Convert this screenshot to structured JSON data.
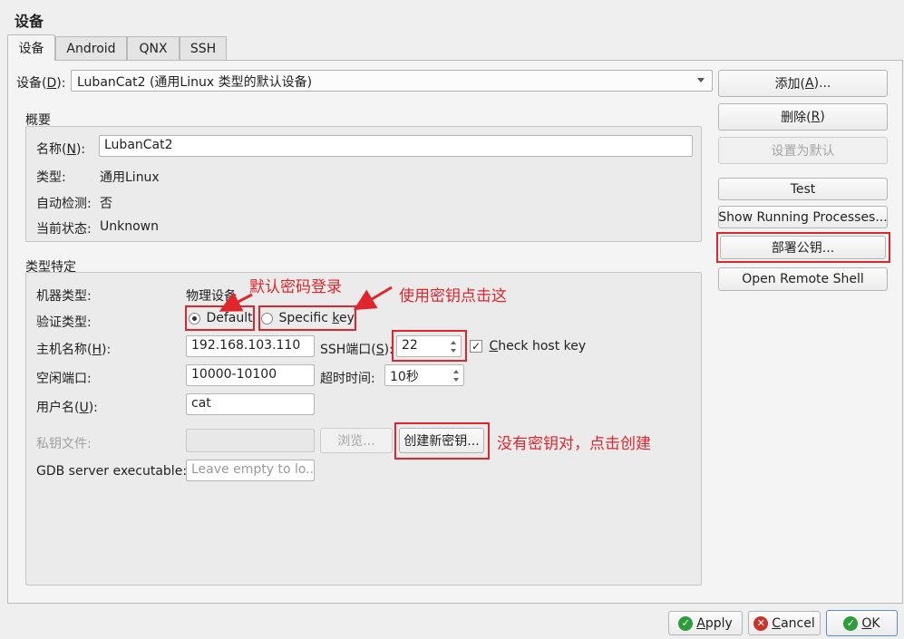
{
  "title": "设备",
  "tabs": [
    {
      "label": "设备"
    },
    {
      "label": "Android"
    },
    {
      "label": "QNX"
    },
    {
      "label": "SSH"
    }
  ],
  "device": {
    "label_prefix": "设备(",
    "label_key": "D",
    "label_suffix": "):",
    "value": "LubanCat2 (通用Linux 类型的默认设备)"
  },
  "overview": {
    "title": "概要",
    "name_label_prefix": "名称(",
    "name_label_key": "N",
    "name_label_suffix": "):",
    "name_value": "LubanCat2",
    "type_label": "类型:",
    "type_value": "通用Linux",
    "autodetect_label": "自动检测:",
    "autodetect_value": "否",
    "state_label": "当前状态:",
    "state_value": "Unknown"
  },
  "specific": {
    "title": "类型特定",
    "machine_type_label": "机器类型:",
    "machine_type_value": "物理设备",
    "auth_label": "验证类型:",
    "auth_default": "Default",
    "auth_specific_prefix": "Specific ",
    "auth_specific_key": "k",
    "auth_specific_suffix": "ey",
    "host_label_prefix": "主机名称(",
    "host_label_key": "H",
    "host_label_suffix": "):",
    "host_value": "192.168.103.110",
    "ssh_port_label_prefix": "SSH端口(",
    "ssh_port_label_key": "S",
    "ssh_port_label_suffix": "):",
    "ssh_port_value": "22",
    "check_host_key_prefix": "",
    "check_host_key_key": "C",
    "check_host_key_suffix": "heck host key",
    "check_host_key_checked": true,
    "free_ports_label": "空闲端口:",
    "free_ports_value": "10000-10100",
    "timeout_label": "超时时间:",
    "timeout_value": "10秒",
    "user_label_prefix": "用户名(",
    "user_label_key": "U",
    "user_label_suffix": "):",
    "user_value": "cat",
    "private_key_label": "私钥文件:",
    "browse_label": "浏览...",
    "create_key_label": "创建新密钥...",
    "gdb_label": "GDB server executable:",
    "gdb_placeholder": "Leave empty to lo..."
  },
  "side_buttons": {
    "add_prefix": "添加(",
    "add_key": "A",
    "add_suffix": ")...",
    "remove_prefix": "删除(",
    "remove_key": "R",
    "remove_suffix": ")",
    "set_default": "设置为默认",
    "test": "Test",
    "show_processes": "Show Running Processes...",
    "deploy_key": "部署公钥...",
    "open_shell": "Open Remote Shell"
  },
  "annotations": {
    "default_login": "默认密码登录",
    "use_key": "使用密钥点击这",
    "no_keypair": "没有密钥对，点击创建"
  },
  "bottom": {
    "apply_prefix": "",
    "apply_key": "A",
    "apply_suffix": "pply",
    "cancel_prefix": "",
    "cancel_key": "C",
    "cancel_suffix": "ancel",
    "ok_prefix": "",
    "ok_key": "O",
    "ok_suffix": "K"
  },
  "colors": {
    "annotation_red": "#e0262d",
    "ok_green": "#2e9c3d",
    "cancel_red": "#c9332b"
  }
}
